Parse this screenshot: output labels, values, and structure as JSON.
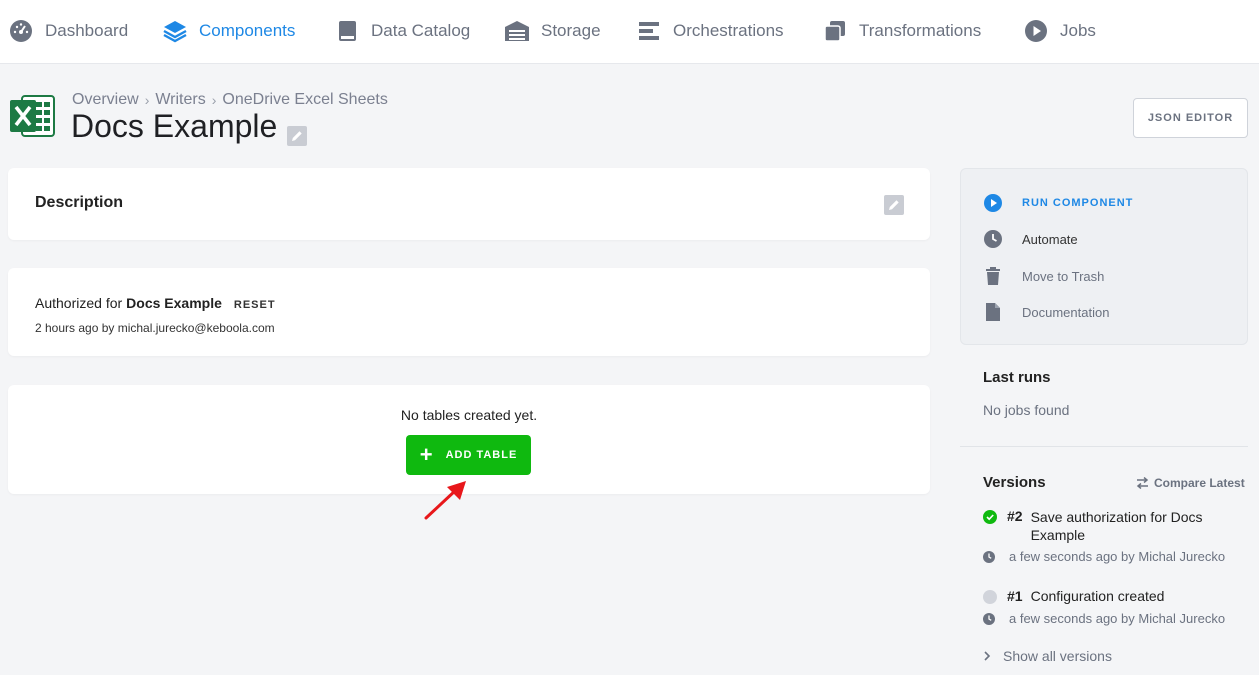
{
  "nav": {
    "items": [
      {
        "label": "Dashboard",
        "icon": "gauge-icon"
      },
      {
        "label": "Components",
        "icon": "layers-icon",
        "active": true
      },
      {
        "label": "Data Catalog",
        "icon": "book-icon"
      },
      {
        "label": "Storage",
        "icon": "warehouse-icon"
      },
      {
        "label": "Orchestrations",
        "icon": "bars-icon"
      },
      {
        "label": "Transformations",
        "icon": "copy-icon"
      },
      {
        "label": "Jobs",
        "icon": "play-circle-icon"
      }
    ]
  },
  "header": {
    "breadcrumb": [
      "Overview",
      "Writers",
      "OneDrive Excel Sheets"
    ],
    "title": "Docs Example",
    "json_editor": "JSON EDITOR"
  },
  "description": {
    "title": "Description"
  },
  "auth": {
    "prefix": "Authorized for",
    "name": "Docs Example",
    "reset": "RESET",
    "meta": "2 hours ago by michal.jurecko@keboola.com"
  },
  "tables": {
    "empty_text": "No tables created yet.",
    "add_label": "ADD TABLE"
  },
  "actions": {
    "run": "RUN COMPONENT",
    "automate": "Automate",
    "trash": "Move to Trash",
    "docs": "Documentation"
  },
  "last_runs": {
    "title": "Last runs",
    "empty": "No jobs found"
  },
  "versions": {
    "title": "Versions",
    "compare": "Compare Latest",
    "items": [
      {
        "num": "#2",
        "desc": "Save authorization for Docs Example",
        "meta": "a few seconds ago by Michal Jurecko",
        "status": "success"
      },
      {
        "num": "#1",
        "desc": "Configuration created",
        "meta": "a few seconds ago by Michal Jurecko",
        "status": "inactive"
      }
    ],
    "show_all": "Show all versions"
  },
  "colors": {
    "accent": "#1e88e5",
    "success": "#0fb90f",
    "annotation_arrow": "#e8171b"
  }
}
